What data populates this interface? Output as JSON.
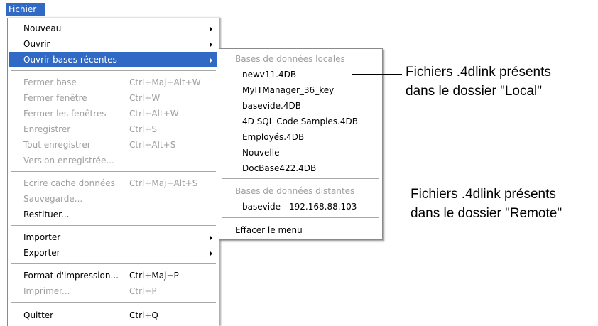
{
  "menubar": {
    "file_label": "Fichier"
  },
  "main_menu": {
    "new": "Nouveau",
    "open": "Ouvrir",
    "open_recent": "Ouvrir bases récentes",
    "close_base": "Fermer base",
    "close_base_shortcut": "Ctrl+Maj+Alt+W",
    "close_window": "Fermer fenêtre",
    "close_window_shortcut": "Ctrl+W",
    "close_windows": "Fermer les fenêtres",
    "close_windows_shortcut": "Ctrl+Alt+W",
    "save": "Enregistrer",
    "save_shortcut": "Ctrl+S",
    "save_all": "Tout enregistrer",
    "save_all_shortcut": "Ctrl+Alt+S",
    "saved_version": "Version enregistrée...",
    "write_cache": "Ecrire cache données",
    "write_cache_shortcut": "Ctrl+Maj+Alt+S",
    "backup": "Sauvegarde...",
    "restore": "Restituer...",
    "import": "Importer",
    "export": "Exporter",
    "print_format": "Format d'impression...",
    "print_format_shortcut": "Ctrl+Maj+P",
    "print": "Imprimer...",
    "print_shortcut": "Ctrl+P",
    "quit": "Quitter",
    "quit_shortcut": "Ctrl+Q"
  },
  "recent_menu": {
    "local_header": "Bases de données locales",
    "local_items": [
      "newv11.4DB",
      "MyITManager_36_key",
      "basevide.4DB",
      "4D SQL Code Samples.4DB",
      "Employés.4DB",
      "Nouvelle",
      "DocBase422.4DB"
    ],
    "remote_header": "Bases de données distantes",
    "remote_items": [
      "basevide - 192.168.88.103"
    ],
    "clear": "Effacer le menu"
  },
  "annotations": {
    "local_line1": "Fichiers .4dlink présents",
    "local_line2": "dans le dossier \"Local\"",
    "remote_line1": "Fichiers .4dlink présents",
    "remote_line2": "dans le dossier \"Remote\""
  },
  "colors": {
    "highlight": "#316ac5",
    "disabled_text": "#a0a0a0"
  }
}
